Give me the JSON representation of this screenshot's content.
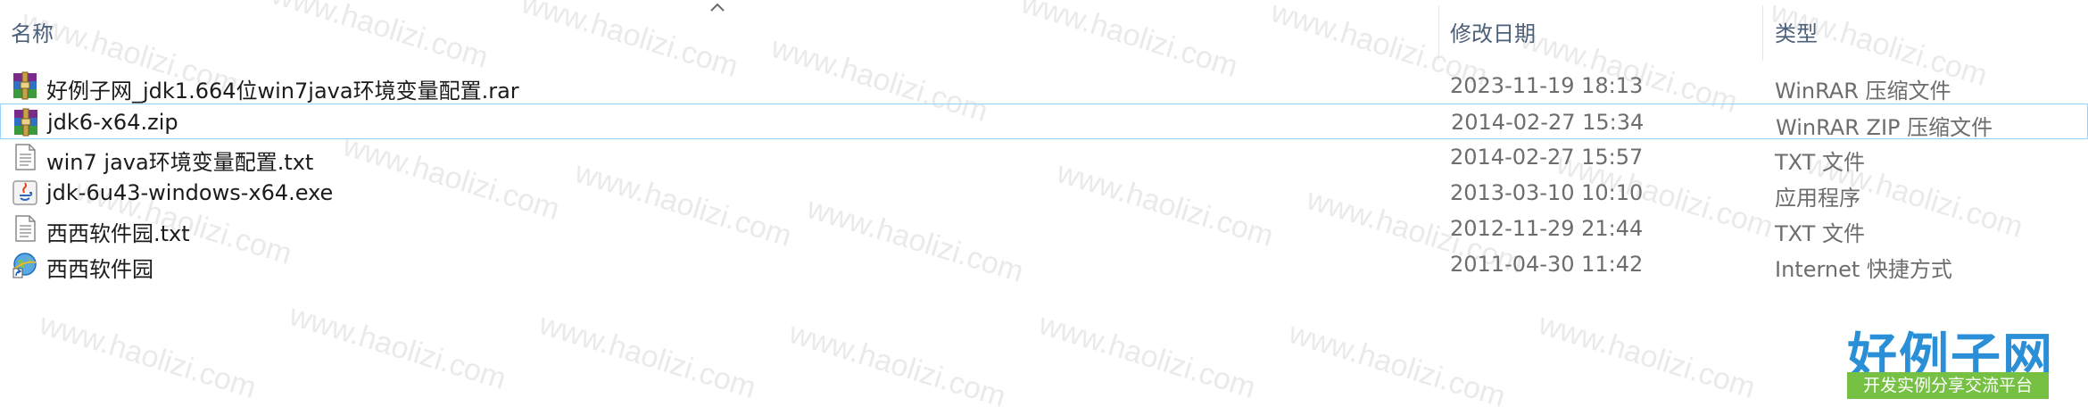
{
  "header": {
    "name_label": "名称",
    "date_label": "修改日期",
    "type_label": "类型"
  },
  "files": [
    {
      "name": "好例子网_jdk1.664位win7java环境变量配置.rar",
      "date": "2023-11-19 18:13",
      "type": "WinRAR 压缩文件",
      "icon": "winrar-archive-icon"
    },
    {
      "name": "jdk6-x64.zip",
      "date": "2014-02-27 15:34",
      "type": "WinRAR ZIP 压缩文件",
      "icon": "winrar-archive-icon"
    },
    {
      "name": "win7 java环境变量配置.txt",
      "date": "2014-02-27 15:57",
      "type": "TXT 文件",
      "icon": "text-file-icon"
    },
    {
      "name": "jdk-6u43-windows-x64.exe",
      "date": "2013-03-10 10:10",
      "type": "应用程序",
      "icon": "java-installer-icon"
    },
    {
      "name": "西西软件园.txt",
      "date": "2012-11-29 21:44",
      "type": "TXT 文件",
      "icon": "text-file-icon"
    },
    {
      "name": "西西软件园",
      "date": "2011-04-30 11:42",
      "type": "Internet 快捷方式",
      "icon": "internet-shortcut-icon"
    }
  ],
  "watermark": "www.haolizi.com",
  "logo": {
    "main": "好例子网",
    "sub": "开发实例分享交流平台"
  }
}
